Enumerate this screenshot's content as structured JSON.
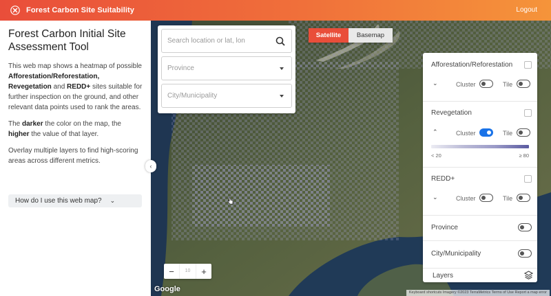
{
  "header": {
    "title": "Forest Carbon Site Suitability",
    "logout_label": "Logout",
    "gradient": [
      "#e94e3a",
      "#f5943a"
    ]
  },
  "sidebar": {
    "title": "Forest Carbon Initial Site Assessment Tool",
    "intro_prefix": "This web map shows a heatmap of possible ",
    "intro_bold1": "Afforestation/Reforestation",
    "intro_mid1": ", ",
    "intro_bold2": "Revegetation",
    "intro_mid2": " and ",
    "intro_bold3": "REDD+",
    "intro_suffix": " sites suitable for further inspection on the ground, and other relevant data points used to rank the areas.",
    "darker_prefix": "The ",
    "darker_bold1": "darker",
    "darker_mid": " the color on the map, the ",
    "darker_bold2": "higher",
    "darker_suffix": " the value of that layer.",
    "overlay_text": "Overlay multiple layers to find high-scoring areas across different metrics.",
    "howto_label": "How do I use this web map?",
    "collapse_icon": "chevron-left-icon"
  },
  "search": {
    "placeholder": "Search location or lat, lon",
    "province_placeholder": "Province",
    "city_placeholder": "City/Municipality"
  },
  "map_type": {
    "satellite_label": "Satellite",
    "basemap_label": "Basemap",
    "active": "Satellite",
    "accent": "#e94e3a"
  },
  "layers": {
    "afforestation": {
      "title": "Afforestation/Reforestation",
      "cluster_label": "Cluster",
      "tile_label": "Tile",
      "cluster_on": false,
      "tile_on": false,
      "expanded": false
    },
    "revegetation": {
      "title": "Revegetation",
      "cluster_label": "Cluster",
      "tile_label": "Tile",
      "cluster_on": true,
      "tile_on": false,
      "expanded": true,
      "legend_low": "< 20",
      "legend_high": "≥ 80"
    },
    "redd": {
      "title": "REDD+",
      "cluster_label": "Cluster",
      "tile_label": "Tile",
      "cluster_on": false,
      "tile_on": false,
      "expanded": false
    },
    "province_label": "Province",
    "city_label": "City/Municipality",
    "footer_label": "Layers",
    "toggle_on_color": "#1a73e8"
  },
  "map": {
    "zoom_level": "10",
    "google_label": "Google",
    "attribution": "Keyboard shortcuts   Imagery ©2023 TerraMetrics   Terms of Use   Report a map error"
  }
}
